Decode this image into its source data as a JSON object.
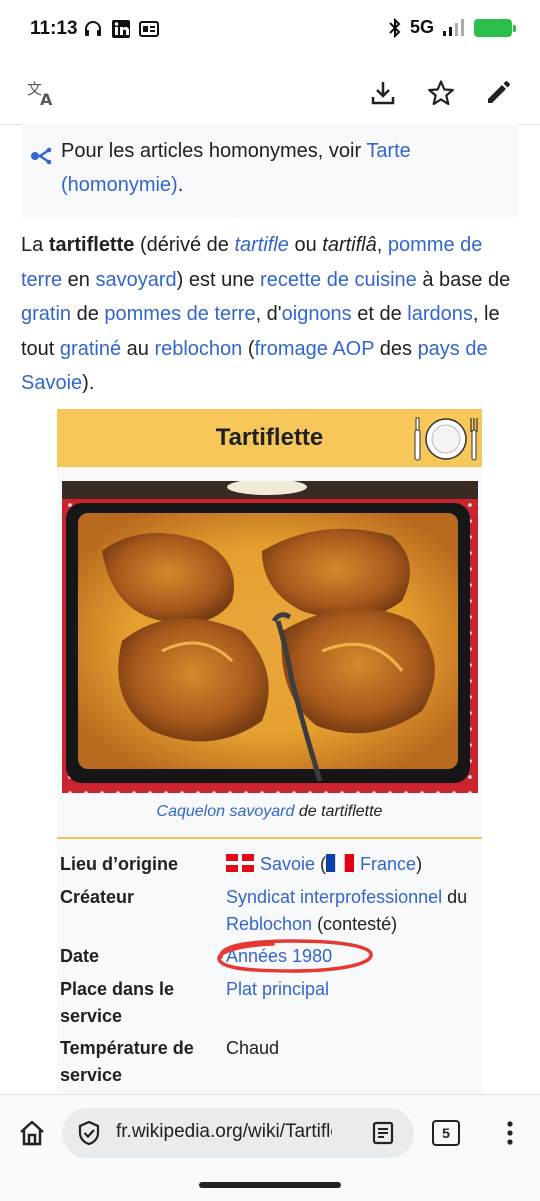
{
  "status_bar": {
    "time": "11:13",
    "network": "5G"
  },
  "toolbar": {
    "translate_icon": "translate-icon",
    "download_icon": "download-icon",
    "star_icon": "star-icon",
    "edit_icon": "edit-pencil-icon"
  },
  "hatnote": {
    "text_before": "Pour les articles homonymes, voir ",
    "link": "Tarte (homonymie)",
    "text_after": "."
  },
  "intro": {
    "t1": "La ",
    "b1": "tartiflette",
    "t2": " (dérivé de ",
    "l1": "tartifle",
    "t3": " ou ",
    "i1": "tartiflâ",
    "t4": ", ",
    "l2": "pomme de terre",
    "t5": " en ",
    "l3": "savoyard",
    "t6": ") est une ",
    "l4": "recette de cuisine",
    "t7": " à base de ",
    "l5": "gratin",
    "t8": " de ",
    "l6": "pommes de terre",
    "t9": ", d'",
    "l7": "oignons",
    "t10": " et de ",
    "l8": "lardons",
    "t11": ", le tout ",
    "l9": "gratiné",
    "t12": " au ",
    "l10": "reblochon",
    "t13": " (",
    "l11": "fromage AOP",
    "t14": " des ",
    "l12": "pays de Savoie",
    "t15": ")."
  },
  "infobox": {
    "title": "Tartiflette",
    "caption_link": "Caquelon savoyard",
    "caption_text": " de tartiflette",
    "rows": [
      {
        "label": "Lieu d’origine",
        "v_link1": "Savoie",
        "v_t1": " (",
        "v_link2": "France",
        "v_t2": ")"
      },
      {
        "label": "Créateur",
        "v_link1": "Syndicat interprofessionnel",
        "v_t1": " du ",
        "v_link2": "Reblochon",
        "v_t2": " (contesté)"
      },
      {
        "label": "Date",
        "v_link1": "Années 1980"
      },
      {
        "label": "Place dans le service",
        "v_link1": "Plat principal"
      },
      {
        "label": "Température de service",
        "v_t1": "Chaud"
      }
    ]
  },
  "browser": {
    "url": "fr.wikipedia.org/wiki/Tartifle",
    "tab_count": "5"
  },
  "colors": {
    "link": "#3366cc",
    "infobox_header": "#f7c75a",
    "annotation": "#e53935"
  }
}
